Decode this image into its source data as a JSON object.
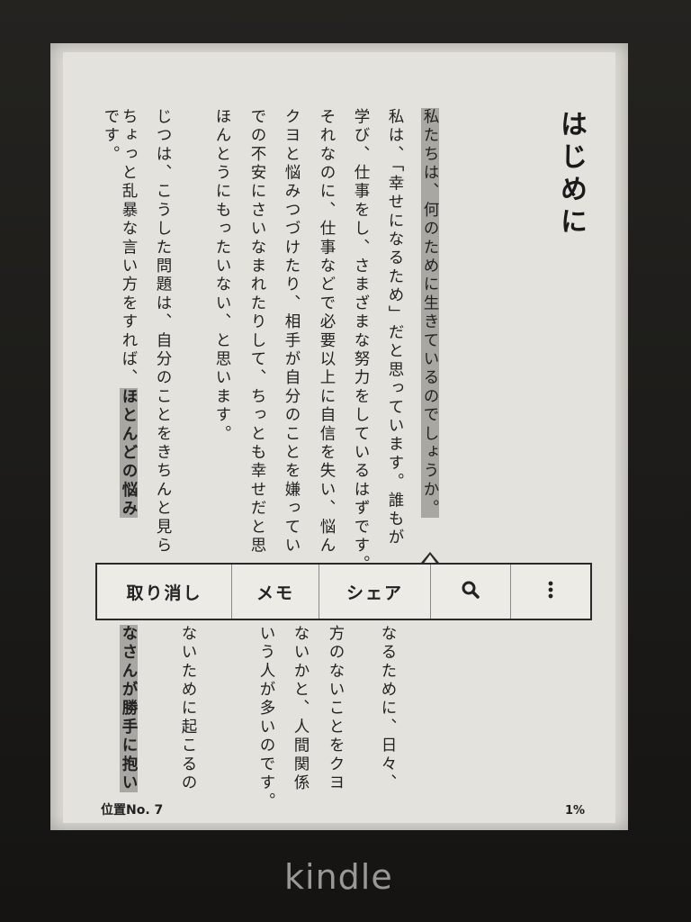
{
  "book": {
    "chapter_title": "はじめに",
    "columns": [
      {
        "id": "c1",
        "segments": [
          {
            "t": "私たちは、何のために生きているのでしょうか。",
            "hl": "gray"
          }
        ]
      },
      {
        "id": "c2",
        "segments": [
          {
            "t": "私は、「幸せになるため」だと思っています。誰もが"
          }
        ]
      },
      {
        "id": "c3",
        "segments": [
          {
            "t": "学び、仕事をし、さまざまな努力をしているはずです。"
          }
        ]
      },
      {
        "id": "c4",
        "segments": [
          {
            "t": "それなのに、仕事などで必要以上に自信を失い、悩ん"
          }
        ]
      },
      {
        "id": "c5",
        "segments": [
          {
            "t": "クヨと悩みつづけたり、相手が自分のことを嫌ってい"
          }
        ]
      },
      {
        "id": "c6",
        "segments": [
          {
            "t": "での不安にさいなまれたりして、ちっとも幸せだと思"
          }
        ]
      },
      {
        "id": "c7",
        "segments": [
          {
            "t": "ほんとうにもったいない、と思います。"
          }
        ]
      },
      {
        "id": "c8",
        "segments": [
          {
            "t": " "
          }
        ]
      },
      {
        "id": "c9",
        "segments": [
          {
            "t": "じつは、こうした問題は、自分のことをきちんと見ら"
          }
        ]
      },
      {
        "id": "c10",
        "segments": [
          {
            "t": "ちょっと乱暴な言い方をすれば、"
          },
          {
            "t": "ほとんどの悩み",
            "hl": "bold"
          }
        ]
      },
      {
        "id": "c11",
        "segments": [
          {
            "t": "です。"
          }
        ]
      }
    ],
    "lower_columns": [
      {
        "id": "l1",
        "segments": [
          {
            "t": "なるために、日々、"
          }
        ]
      },
      {
        "id": "l2",
        "segments": [
          {
            "t": "方のないことをクヨ"
          }
        ]
      },
      {
        "id": "l3",
        "segments": [
          {
            "t": "ないかと、人間関係"
          }
        ]
      },
      {
        "id": "l4",
        "segments": [
          {
            "t": "いう人が多いのです。"
          }
        ]
      },
      {
        "id": "l5",
        "segments": [
          {
            "t": " "
          }
        ]
      },
      {
        "id": "l6",
        "segments": [
          {
            "t": "ないために起こるの"
          }
        ]
      },
      {
        "id": "l7",
        "segments": [
          {
            "t": "なさんが勝手に抱い",
            "hl": "bold"
          }
        ]
      }
    ]
  },
  "popup_menu": {
    "undo_label": "取り消し",
    "memo_label": "メモ",
    "share_label": "シェア",
    "search_icon": "search-icon",
    "more_icon": "more-vertical-icon"
  },
  "footer": {
    "location_label": "位置No. 7",
    "progress_label": "1%"
  },
  "device": {
    "brand": "kindle"
  },
  "colors": {
    "highlight": "#a9a7a2",
    "paper": "#e4e2dc",
    "bezel": "#1c1b19"
  }
}
